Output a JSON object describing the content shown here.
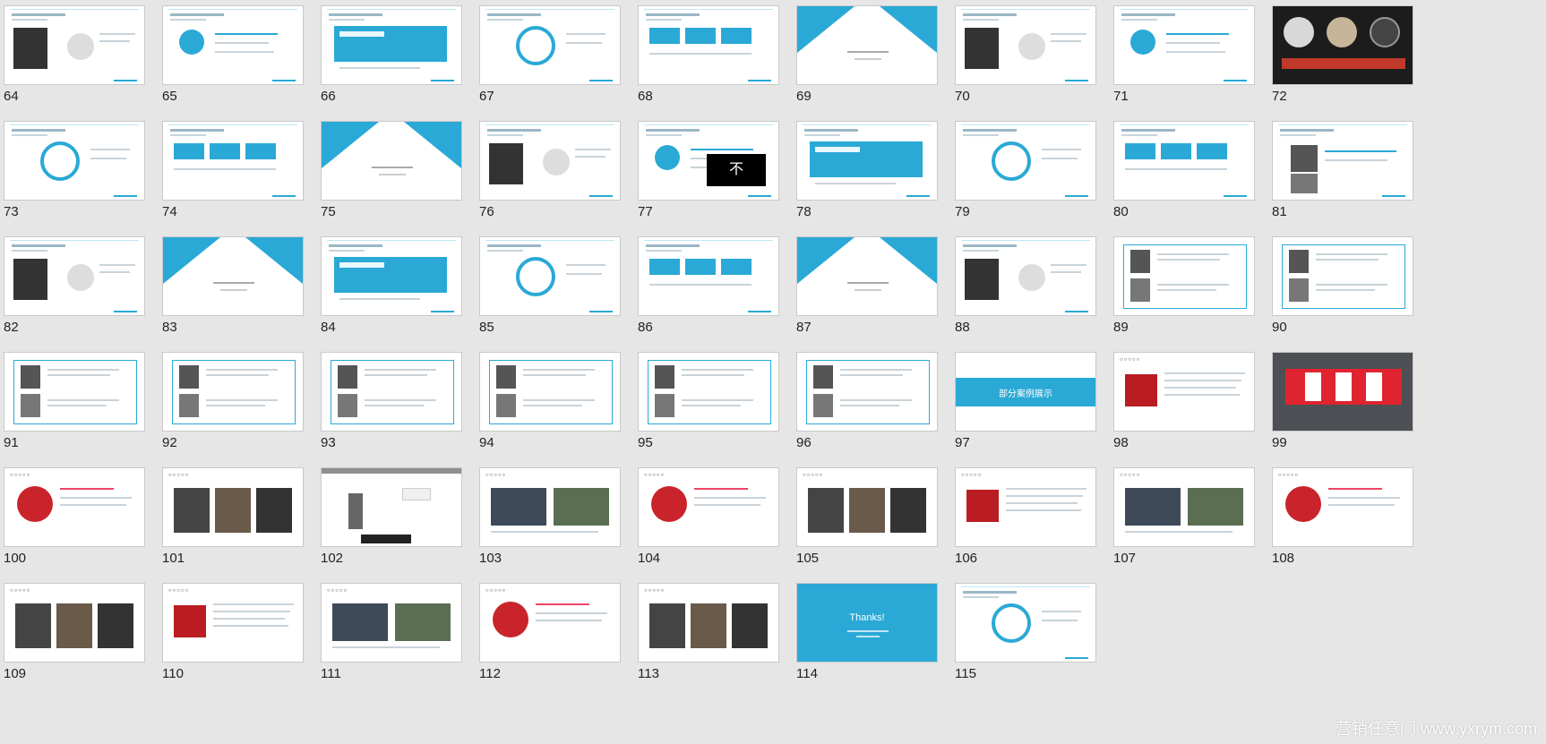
{
  "slides": [
    {
      "number": "64",
      "kind": "content"
    },
    {
      "number": "65",
      "kind": "content"
    },
    {
      "number": "66",
      "kind": "content"
    },
    {
      "number": "67",
      "kind": "content"
    },
    {
      "number": "68",
      "kind": "content"
    },
    {
      "number": "69",
      "kind": "title"
    },
    {
      "number": "70",
      "kind": "content"
    },
    {
      "number": "71",
      "kind": "content"
    },
    {
      "number": "72",
      "kind": "dark-photos"
    },
    {
      "number": "73",
      "kind": "content"
    },
    {
      "number": "74",
      "kind": "content"
    },
    {
      "number": "75",
      "kind": "title"
    },
    {
      "number": "76",
      "kind": "content"
    },
    {
      "number": "77",
      "kind": "content",
      "big_text": "不"
    },
    {
      "number": "78",
      "kind": "content"
    },
    {
      "number": "79",
      "kind": "content"
    },
    {
      "number": "80",
      "kind": "content"
    },
    {
      "number": "81",
      "kind": "content"
    },
    {
      "number": "82",
      "kind": "content"
    },
    {
      "number": "83",
      "kind": "title"
    },
    {
      "number": "84",
      "kind": "content"
    },
    {
      "number": "85",
      "kind": "content"
    },
    {
      "number": "86",
      "kind": "content"
    },
    {
      "number": "87",
      "kind": "title"
    },
    {
      "number": "88",
      "kind": "content"
    },
    {
      "number": "89",
      "kind": "profile"
    },
    {
      "number": "90",
      "kind": "profile"
    },
    {
      "number": "91",
      "kind": "profile"
    },
    {
      "number": "92",
      "kind": "profile"
    },
    {
      "number": "93",
      "kind": "profile"
    },
    {
      "number": "94",
      "kind": "profile"
    },
    {
      "number": "95",
      "kind": "profile"
    },
    {
      "number": "96",
      "kind": "profile"
    },
    {
      "number": "97",
      "kind": "banner",
      "banner_text": "部分案例展示"
    },
    {
      "number": "98",
      "kind": "case"
    },
    {
      "number": "99",
      "kind": "dark-case"
    },
    {
      "number": "100",
      "kind": "case"
    },
    {
      "number": "101",
      "kind": "case"
    },
    {
      "number": "102",
      "kind": "photo"
    },
    {
      "number": "103",
      "kind": "case"
    },
    {
      "number": "104",
      "kind": "case"
    },
    {
      "number": "105",
      "kind": "case"
    },
    {
      "number": "106",
      "kind": "case"
    },
    {
      "number": "107",
      "kind": "case"
    },
    {
      "number": "108",
      "kind": "case"
    },
    {
      "number": "109",
      "kind": "case"
    },
    {
      "number": "110",
      "kind": "case"
    },
    {
      "number": "111",
      "kind": "case"
    },
    {
      "number": "112",
      "kind": "case"
    },
    {
      "number": "113",
      "kind": "case"
    },
    {
      "number": "114",
      "kind": "thanks",
      "title": "Thanks!"
    },
    {
      "number": "115",
      "kind": "content"
    }
  ],
  "watermark": "营销任意门 www.yxrym.com",
  "colors": {
    "accent": "#2aa9d6",
    "background": "#e6e6e6",
    "thumb": "#ffffff",
    "number_text": "#222222"
  }
}
